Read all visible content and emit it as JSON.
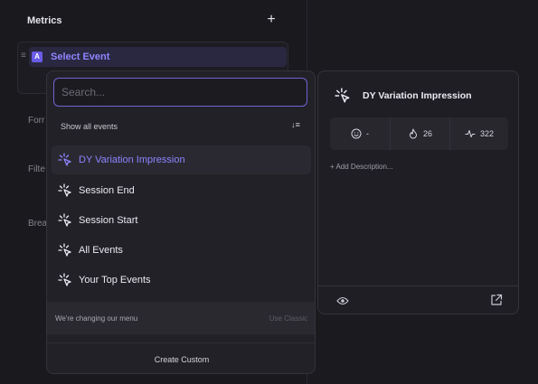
{
  "left_panel": {
    "title": "Metrics",
    "add_label": "+",
    "metric": {
      "letter": "A",
      "label": "Select Event"
    },
    "side_labels": [
      "Forr",
      "Filte",
      "Brea"
    ]
  },
  "dropdown": {
    "search_placeholder": "Search...",
    "filter_label": "Show all events",
    "sort_icon": "sort-icon",
    "items": [
      {
        "label": "DY Variation Impression",
        "active": true,
        "icon": "sparkle-cursor-icon"
      },
      {
        "label": "Session End",
        "active": false,
        "icon": "sparkle-cursor-icon"
      },
      {
        "label": "Session Start",
        "active": false,
        "icon": "sparkle-cursor-icon"
      },
      {
        "label": "All Events",
        "active": false,
        "icon": "sparkle-cursor-icon"
      },
      {
        "label": "Your Top Events",
        "active": false,
        "icon": "sparkle-cursor-icon"
      }
    ],
    "footer_text": "We're changing our menu",
    "use_classic": "Use Classic",
    "create_custom": "Create Custom"
  },
  "detail": {
    "title": "DY Variation Impression",
    "stats": [
      {
        "icon": "smiley-icon",
        "value": "-"
      },
      {
        "icon": "flame-icon",
        "value": "26"
      },
      {
        "icon": "pulse-icon",
        "value": "322"
      }
    ],
    "add_description": "+ Add Description..."
  },
  "colors": {
    "accent": "#8f84ff",
    "accent_border": "#6f63d6",
    "background": "#18171c",
    "panel": "#222127"
  }
}
